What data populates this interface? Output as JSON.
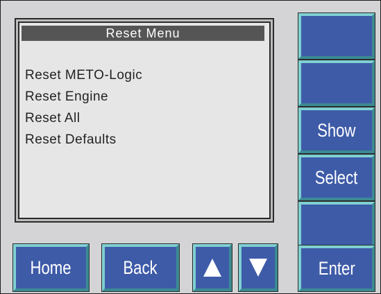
{
  "screen": {
    "title": "Reset Menu",
    "items": [
      "Reset METO-Logic",
      "Reset Engine",
      "Reset All",
      "Reset Defaults"
    ]
  },
  "softkeys": {
    "key1": "",
    "key2": "",
    "show": "Show",
    "select": "Select",
    "key5": "",
    "enter": "Enter"
  },
  "bottom": {
    "home": "Home",
    "back": "Back",
    "up_icon": "up-arrow-icon",
    "down_icon": "down-arrow-icon"
  },
  "colors": {
    "button_face": "#3e5ba8",
    "button_highlight": "#7fd0d2",
    "screen_title_bg": "#555555",
    "panel_bg": "#d4d4d6"
  }
}
